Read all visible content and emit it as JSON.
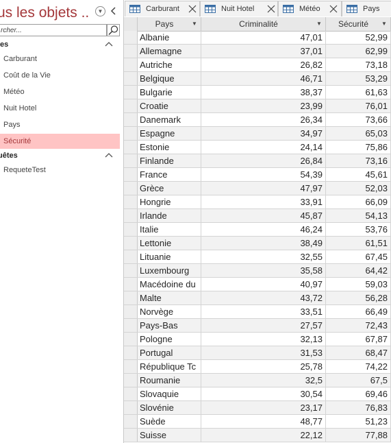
{
  "nav": {
    "title": "us les objets ...",
    "search_placeholder": "rcher...",
    "groups": [
      {
        "label": "ies",
        "items": [
          {
            "label": "Carburant",
            "selected": false
          },
          {
            "label": "Coût de la Vie",
            "selected": false
          },
          {
            "label": "Météo",
            "selected": false
          },
          {
            "label": "Nuit Hotel",
            "selected": false
          },
          {
            "label": "Pays",
            "selected": false
          },
          {
            "label": "Sécurité",
            "selected": true
          }
        ]
      },
      {
        "label": "uêtes",
        "items": [
          {
            "label": "RequeteTest",
            "selected": false
          }
        ]
      }
    ]
  },
  "tabs": [
    {
      "label": "Carburant",
      "icon": "table-icon"
    },
    {
      "label": "Nuit Hotel",
      "icon": "table-icon"
    },
    {
      "label": "Météo",
      "icon": "table-icon"
    },
    {
      "label": "Pays",
      "icon": "table-icon"
    }
  ],
  "columns": [
    {
      "label": "Pays",
      "align": "left",
      "sortable": true
    },
    {
      "label": "Criminalité",
      "align": "right",
      "sortable": true
    },
    {
      "label": "Sécurité",
      "align": "right",
      "sortable": true
    }
  ],
  "rows": [
    [
      "Albanie",
      "47,01",
      "52,99"
    ],
    [
      "Allemagne",
      "37,01",
      "62,99"
    ],
    [
      "Autriche",
      "26,82",
      "73,18"
    ],
    [
      "Belgique",
      "46,71",
      "53,29"
    ],
    [
      "Bulgarie",
      "38,37",
      "61,63"
    ],
    [
      "Croatie",
      "23,99",
      "76,01"
    ],
    [
      "Danemark",
      "26,34",
      "73,66"
    ],
    [
      "Espagne",
      "34,97",
      "65,03"
    ],
    [
      "Estonie",
      "24,14",
      "75,86"
    ],
    [
      "Finlande",
      "26,84",
      "73,16"
    ],
    [
      "France",
      "54,39",
      "45,61"
    ],
    [
      "Grèce",
      "47,97",
      "52,03"
    ],
    [
      "Hongrie",
      "33,91",
      "66,09"
    ],
    [
      "Irlande",
      "45,87",
      "54,13"
    ],
    [
      "Italie",
      "46,24",
      "53,76"
    ],
    [
      "Lettonie",
      "38,49",
      "61,51"
    ],
    [
      "Lituanie",
      "32,55",
      "67,45"
    ],
    [
      "Luxembourg",
      "35,58",
      "64,42"
    ],
    [
      "Macédoine du",
      "40,97",
      "59,03"
    ],
    [
      "Malte",
      "43,72",
      "56,28"
    ],
    [
      "Norvège",
      "33,51",
      "66,49"
    ],
    [
      "Pays-Bas",
      "27,57",
      "72,43"
    ],
    [
      "Pologne",
      "32,13",
      "67,87"
    ],
    [
      "Portugal",
      "31,53",
      "68,47"
    ],
    [
      "République Tc",
      "25,78",
      "74,22"
    ],
    [
      "Roumanie",
      "32,5",
      "67,5"
    ],
    [
      "Slovaquie",
      "30,54",
      "69,46"
    ],
    [
      "Slovénie",
      "23,17",
      "76,83"
    ],
    [
      "Suède",
      "48,77",
      "51,23"
    ],
    [
      "Suisse",
      "22,12",
      "77,88"
    ]
  ],
  "colors": {
    "accent": "#a4373a",
    "selected_bg": "#ffc4c4",
    "alt_row": "#f2f2f2"
  }
}
